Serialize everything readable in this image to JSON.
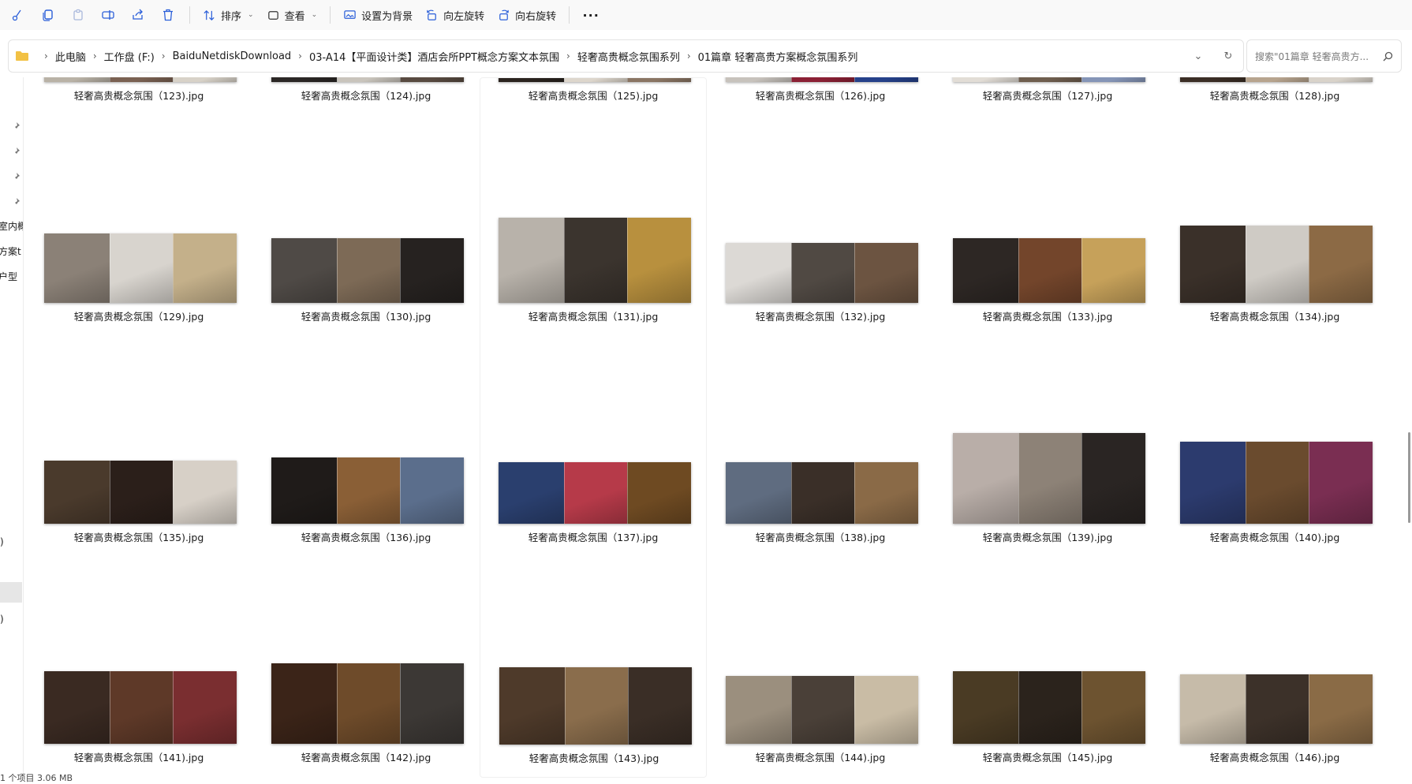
{
  "toolbar": {
    "icons": [
      "cut-icon",
      "copy-icon",
      "paste-icon",
      "rename-icon",
      "share-icon",
      "delete-icon"
    ],
    "sort_label": "排序",
    "view_label": "查看",
    "set_background_label": "设置为背景",
    "rotate_left_label": "向左旋转",
    "rotate_right_label": "向右旋转",
    "more_label": "···"
  },
  "address": {
    "crumbs": [
      "此电脑",
      "工作盘 (F:)",
      "BaiduNetdiskDownload",
      "03-A14【平面设计类】酒店会所PPT概念方案文本氛围",
      "轻奢高贵概念氛围系列",
      "01篇章  轻奢高贵方案概念氛围系列"
    ]
  },
  "search": {
    "placeholder": "搜索\"01篇章  轻奢高贵方..."
  },
  "left_pane": {
    "fragments": [
      "室内概",
      "方案t",
      "户型",
      ")",
      ")"
    ]
  },
  "files": [
    {
      "name": "轻奢高贵概念氛围（123).jpg",
      "colors": [
        "#b9b2a6",
        "#7a6152",
        "#d8d2c8"
      ]
    },
    {
      "name": "轻奢高贵概念氛围（124).jpg",
      "colors": [
        "#2b2725",
        "#c9c4bc",
        "#584a40"
      ]
    },
    {
      "name": "轻奢高贵概念氛围（125).jpg",
      "colors": [
        "#2a231e",
        "#ddd6cc",
        "#8a7563"
      ]
    },
    {
      "name": "轻奢高贵概念氛围（126).jpg",
      "colors": [
        "#c7c2bc",
        "#8b2034",
        "#25418a"
      ]
    },
    {
      "name": "轻奢高贵概念氛围（127).jpg",
      "colors": [
        "#e2ddd6",
        "#6f5e4e",
        "#8595b7"
      ]
    },
    {
      "name": "轻奢高贵概念氛围（128).jpg",
      "colors": [
        "#3b2e25",
        "#b7a48e",
        "#d9d3ca"
      ]
    },
    {
      "name": "轻奢高贵概念氛围（129).jpg",
      "colors": [
        "#8b8177",
        "#d8d4ce",
        "#c4b08a"
      ]
    },
    {
      "name": "轻奢高贵概念氛围（130).jpg",
      "colors": [
        "#4f4a46",
        "#7d6a56",
        "#262220"
      ]
    },
    {
      "name": "轻奢高贵概念氛围（131).jpg",
      "colors": [
        "#b8b2aa",
        "#3b342e",
        "#b8903e"
      ]
    },
    {
      "name": "轻奢高贵概念氛围（132).jpg",
      "colors": [
        "#dcd9d5",
        "#504943",
        "#6c5441"
      ]
    },
    {
      "name": "轻奢高贵概念氛围（133).jpg",
      "colors": [
        "#2d2724",
        "#73452b",
        "#c6a15a"
      ]
    },
    {
      "name": "轻奢高贵概念氛围（134).jpg",
      "colors": [
        "#3a3029",
        "#cfcbc5",
        "#8c6a45"
      ]
    },
    {
      "name": "轻奢高贵概念氛围（135).jpg",
      "colors": [
        "#4a3a2c",
        "#2b1f1a",
        "#d7d0c7"
      ]
    },
    {
      "name": "轻奢高贵概念氛围（136).jpg",
      "colors": [
        "#1f1b19",
        "#8a5f36",
        "#5b6e8c"
      ]
    },
    {
      "name": "轻奢高贵概念氛围（137).jpg",
      "colors": [
        "#2a3f6e",
        "#b63a49",
        "#6e4a22"
      ]
    },
    {
      "name": "轻奢高贵概念氛围（138).jpg",
      "colors": [
        "#5f6c80",
        "#3a2f28",
        "#8a6a47"
      ]
    },
    {
      "name": "轻奢高贵概念氛围（139).jpg",
      "colors": [
        "#b9aea8",
        "#8d8277",
        "#2a2523"
      ]
    },
    {
      "name": "轻奢高贵概念氛围（140).jpg",
      "colors": [
        "#2c3b6e",
        "#6a4b2e",
        "#7a2e52"
      ]
    },
    {
      "name": "轻奢高贵概念氛围（141).jpg",
      "colors": [
        "#3a2a22",
        "#5e3928",
        "#7a2e30"
      ]
    },
    {
      "name": "轻奢高贵概念氛围（142).jpg",
      "colors": [
        "#3b2418",
        "#6e4b2a",
        "#3c3835"
      ]
    },
    {
      "name": "轻奢高贵概念氛围（143).jpg",
      "colors": [
        "#4e3a2a",
        "#8a6d4c",
        "#3a2e26"
      ]
    },
    {
      "name": "轻奢高贵概念氛围（144).jpg",
      "colors": [
        "#9b8f7e",
        "#4a4038",
        "#c9bca5"
      ]
    },
    {
      "name": "轻奢高贵概念氛围（145).jpg",
      "colors": [
        "#4a3b24",
        "#2b231c",
        "#6d5330"
      ]
    },
    {
      "name": "轻奢高贵概念氛围（146).jpg",
      "colors": [
        "#c6bba9",
        "#3c3129",
        "#8a6b46"
      ]
    }
  ],
  "status": {
    "text": "1 个项目  3.06 MB"
  },
  "colors": {
    "toolbar_bg": "#f9f9f9",
    "folder_icon": "#f2c144"
  }
}
